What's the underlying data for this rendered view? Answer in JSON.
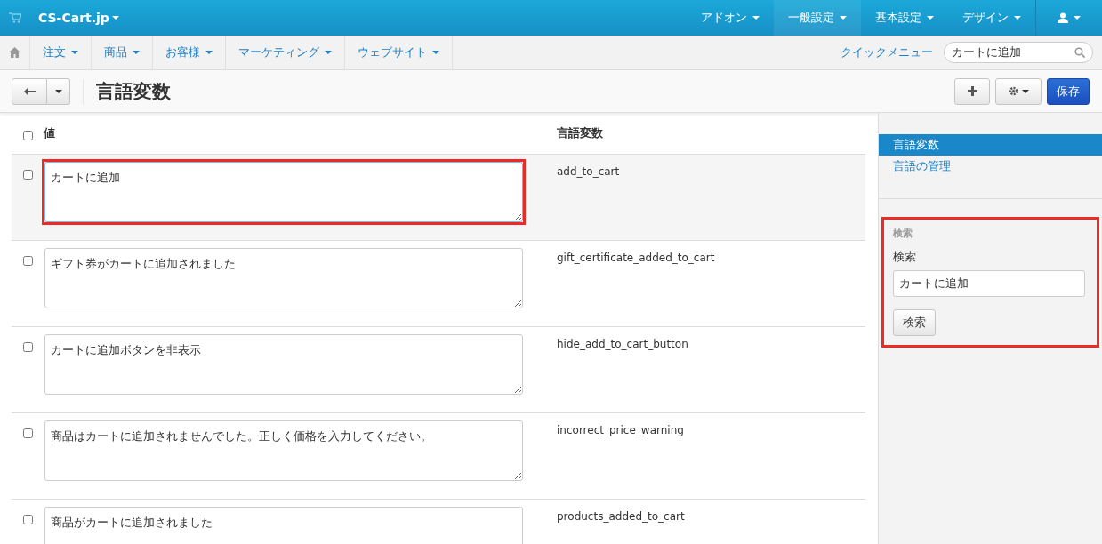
{
  "top_bar": {
    "brand": "CS-Cart.jp",
    "menus": [
      {
        "label": "アドオン",
        "selected": false
      },
      {
        "label": "一般設定",
        "selected": true
      },
      {
        "label": "基本設定",
        "selected": false
      },
      {
        "label": "デザイン",
        "selected": false
      }
    ]
  },
  "nav": {
    "items": [
      "注文",
      "商品",
      "お客様",
      "マーケティング",
      "ウェブサイト"
    ],
    "quick_menu": "クイックメニュー",
    "search_value": "カートに追加"
  },
  "toolbar": {
    "title": "言語変数",
    "save": "保存"
  },
  "table": {
    "columns": [
      "値",
      "言語変数"
    ],
    "header_checked": false,
    "rows": [
      {
        "value": "カートに追加",
        "name": "add_to_cart",
        "checked": false,
        "highlighted": true
      },
      {
        "value": "ギフト券がカートに追加されました",
        "name": "gift_certificate_added_to_cart",
        "checked": false,
        "highlighted": false
      },
      {
        "value": "カートに追加ボタンを非表示",
        "name": "hide_add_to_cart_button",
        "checked": false,
        "highlighted": false
      },
      {
        "value": "商品はカートに追加されませんでした。正しく価格を入力してください。",
        "name": "incorrect_price_warning",
        "checked": false,
        "highlighted": false
      },
      {
        "value": "商品がカートに追加されました",
        "name": "products_added_to_cart",
        "checked": false,
        "highlighted": false
      }
    ]
  },
  "sidebar": {
    "items": [
      {
        "label": "言語変数",
        "selected": true
      },
      {
        "label": "言語の管理",
        "selected": false
      }
    ],
    "search": {
      "highlighted": true,
      "heading": "検索",
      "label": "検索",
      "value": "カートに追加",
      "button": "検索"
    }
  }
}
